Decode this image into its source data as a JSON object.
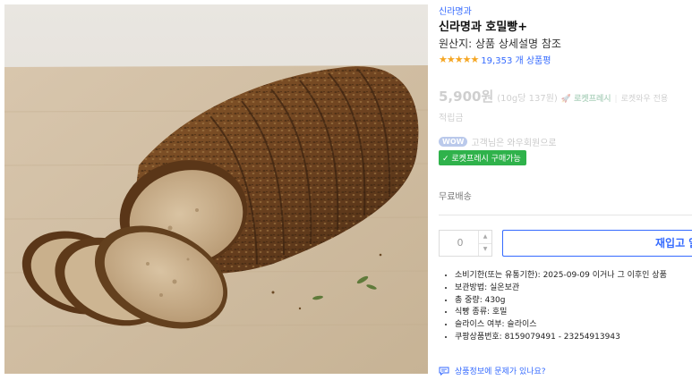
{
  "product": {
    "brand": "신라명과",
    "title": "신라명과 호밀빵+",
    "origin": "원산지: 상품 상세설명 참조",
    "rating_stars": "★★★★★",
    "review_count": "19,353 개 상품평",
    "image_icon": "bread-photo"
  },
  "pricing": {
    "price": "5,900원",
    "unit_price": "(10g당 137원)",
    "rocket_label": "🚀 로켓프레시",
    "separator": "|",
    "rocket_note": "로켓와우 전용",
    "points": "적립금",
    "wow_badge": "WOW",
    "wow_text": "고객님은 와우회원으로",
    "rocket_chip": "✓ 로켓프레시 구매가능"
  },
  "shipping": {
    "label": "무료배송"
  },
  "purchase": {
    "quantity": "0",
    "up_arrow": "▲",
    "down_arrow": "▼",
    "restock_button": "재입고 알림"
  },
  "specs": [
    "소비기한(또는 유통기한): 2025-09-09 이거나 그 이후인 상품",
    "보관방법: 실온보관",
    "총 중량: 430g",
    "식빵 종류: 호밀",
    "슬라이스 여부: 슬라이스",
    "쿠팡상품번호: 8159079491 - 23254913943"
  ],
  "report": {
    "icon": "chat-report-icon",
    "text": "상품정보에 문제가 있나요?"
  },
  "colors": {
    "link_blue": "#346aff",
    "star": "#f5a623",
    "rocket_green": "#2fb24b"
  }
}
